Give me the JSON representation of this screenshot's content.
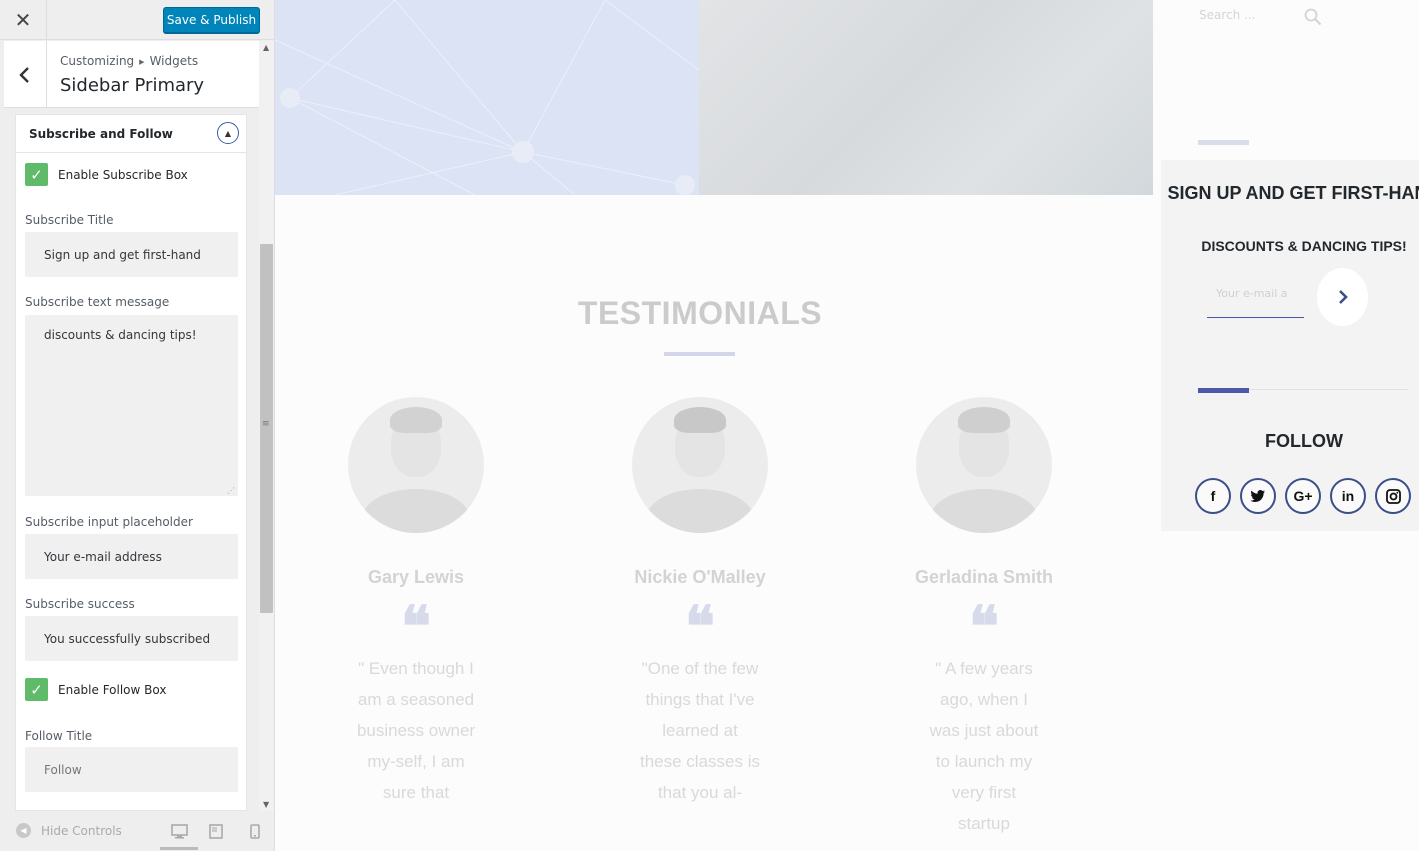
{
  "customizer": {
    "close_icon": "close-icon",
    "publish_label": "Save & Publish",
    "breadcrumb": {
      "root": "Customizing",
      "separator_icon": "triangle-right-icon",
      "current": "Widgets"
    },
    "section_title": "Sidebar Primary",
    "widget": {
      "title": "Subscribe and Follow",
      "enable_subscribe_label": "Enable Subscribe Box",
      "subscribe_title_label": "Subscribe Title",
      "subscribe_title_value": "Sign up and get first-hand",
      "subscribe_text_label": "Subscribe text message",
      "subscribe_text_value": "discounts & dancing tips!",
      "placeholder_label": "Subscribe input placeholder",
      "placeholder_value": "Your e-mail address",
      "success_label": "Subscribe success",
      "success_value": "You successfully subscribed",
      "enable_follow_label": "Enable Follow Box",
      "follow_title_label": "Follow Title",
      "follow_title_value": "Follow"
    },
    "footer": {
      "hide_controls_label": "Hide Controls",
      "devices": [
        "desktop",
        "tablet",
        "mobile"
      ]
    }
  },
  "preview": {
    "testimonials_title": "TESTIMONIALS",
    "testimonials": [
      {
        "name": "Gary Lewis",
        "text": "\" Even though I am a seasoned business owner my-self, I am sure that"
      },
      {
        "name": "Nickie O'Malley",
        "text": "\"One of the few things that I've learned at these classes is that you al-"
      },
      {
        "name": "Gerladina Smith",
        "text": "\" A few years ago, when I was just about to launch my very first startup"
      }
    ],
    "sidebar": {
      "search_placeholder": "Search ...",
      "subscribe_title": "SIGN UP AND GET FIRST-HAND",
      "subscribe_message": "DISCOUNTS & DANCING TIPS!",
      "email_placeholder": "Your e-mail a",
      "follow_title": "FOLLOW",
      "social": [
        "f",
        "t",
        "G+",
        "in",
        "ig"
      ]
    },
    "colors": {
      "accent": "#4a5aa8",
      "publish": "#0085ba",
      "checkbox": "#5fbb6a"
    }
  }
}
